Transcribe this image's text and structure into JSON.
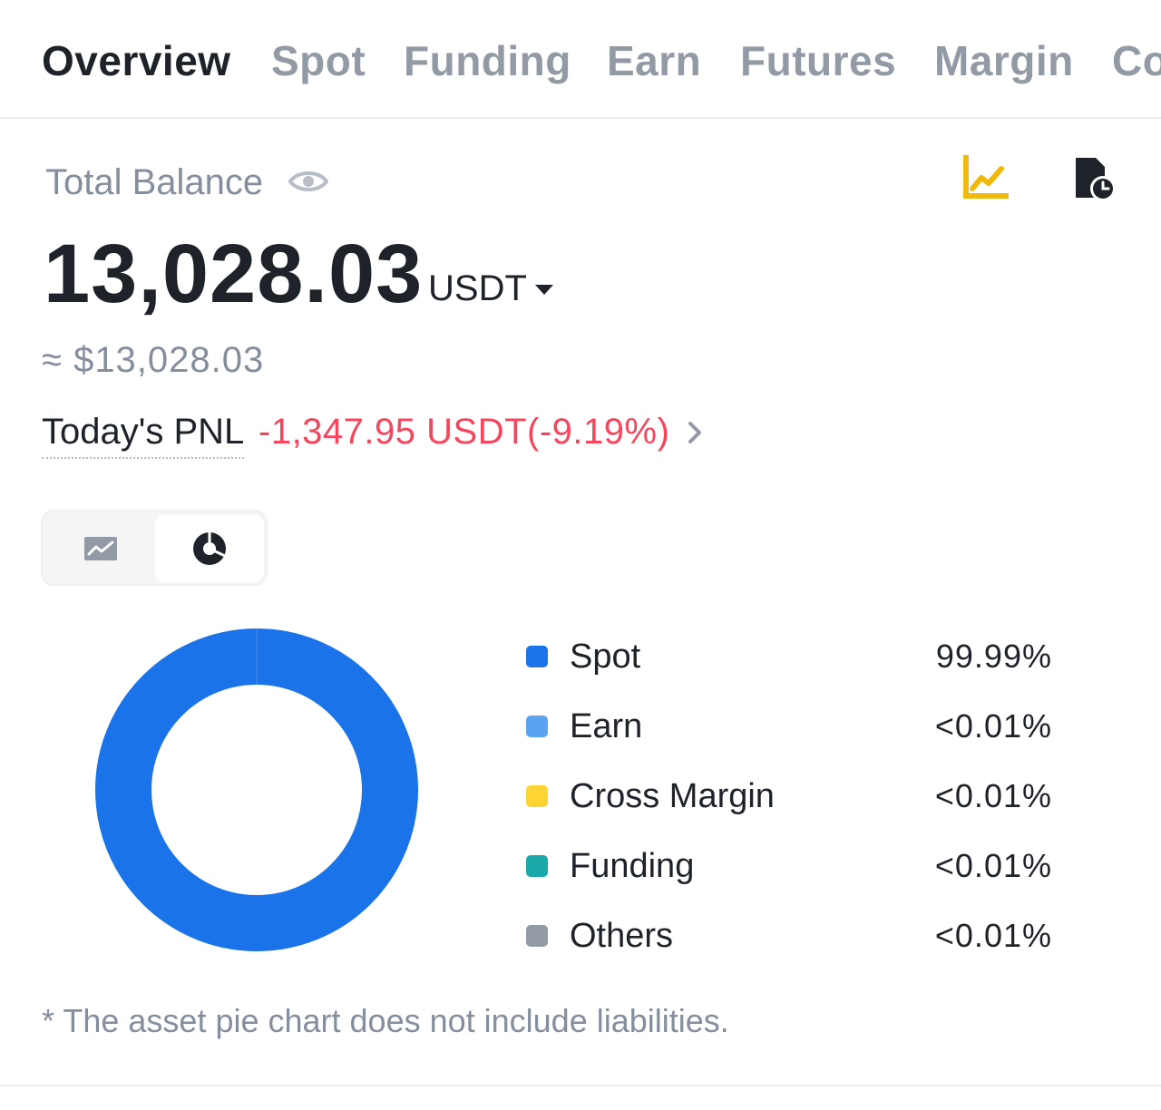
{
  "tabs": [
    {
      "label": "Overview",
      "active": true
    },
    {
      "label": "Spot",
      "active": false
    },
    {
      "label": "Funding",
      "active": false
    },
    {
      "label": "Earn",
      "active": false
    },
    {
      "label": "Futures",
      "active": false
    },
    {
      "label": "Margin",
      "active": false
    },
    {
      "label": "Co",
      "active": false
    }
  ],
  "balance": {
    "label": "Total Balance",
    "amount": "13,028.03",
    "currency": "USDT",
    "approx": "≈ $13,028.03"
  },
  "pnl": {
    "label": "Today's PNL",
    "value": "-1,347.95 USDT(-9.19%)"
  },
  "icons": {
    "visibility": "eye-icon",
    "chart": "line-chart-icon",
    "history": "history-icon",
    "currency_caret": "caret-down-icon",
    "pnl_arrow": "chevron-right-icon",
    "toggle_line": "line-chart-toggle-icon",
    "toggle_pie": "pie-chart-toggle-icon"
  },
  "colors": {
    "accent_yellow": "#f0b90b",
    "negative": "#f6465d",
    "spot": "#1a73e8",
    "earn": "#5aa3f0",
    "cross_margin": "#fcd535",
    "funding": "#1aa8a8",
    "others": "#929aa5"
  },
  "allocation": {
    "items": [
      {
        "label": "Spot",
        "pct": "99.99%",
        "color": "#1a73e8"
      },
      {
        "label": "Earn",
        "pct": "<0.01%",
        "color": "#5aa3f0"
      },
      {
        "label": "Cross Margin",
        "pct": "<0.01%",
        "color": "#fcd535"
      },
      {
        "label": "Funding",
        "pct": "<0.01%",
        "color": "#1aa8a8"
      },
      {
        "label": "Others",
        "pct": "<0.01%",
        "color": "#929aa5"
      }
    ],
    "footnote": "* The asset pie chart does not include liabilities."
  }
}
